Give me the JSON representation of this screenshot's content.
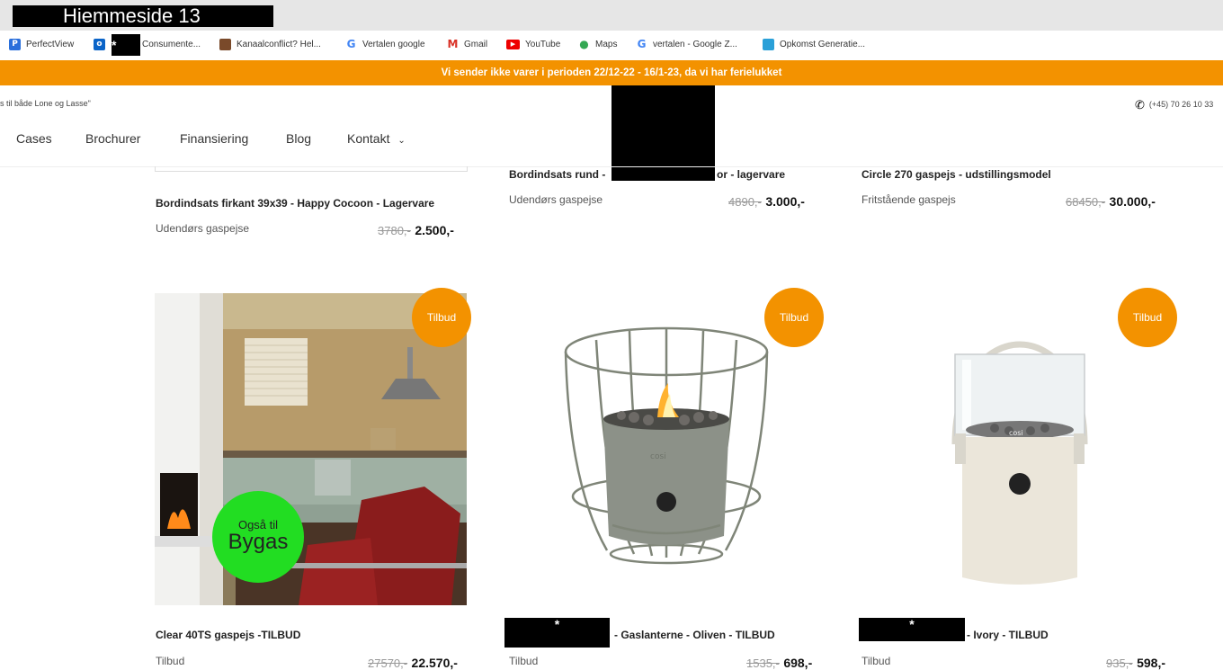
{
  "browser": {
    "tab_title": "Hiemmeside 13",
    "bookmarks": [
      {
        "label": "PerfectView",
        "icon": "perfectview-icon"
      },
      {
        "label": "",
        "icon": "outlook-icon"
      },
      {
        "label": "*",
        "icon": "redacted"
      },
      {
        "label": "Consumente...",
        "icon": ""
      },
      {
        "label": "Kanaalconflict? Hel...",
        "icon": "bookmark-image-icon"
      },
      {
        "label": "Vertalen google",
        "icon": "google-icon"
      },
      {
        "label": "Gmail",
        "icon": "gmail-icon"
      },
      {
        "label": "YouTube",
        "icon": "youtube-icon"
      },
      {
        "label": "Maps",
        "icon": "maps-icon"
      },
      {
        "label": "vertalen - Google Z...",
        "icon": "google-icon"
      },
      {
        "label": "Opkomst Generatie...",
        "icon": "page-icon"
      }
    ]
  },
  "banner": {
    "text": "Vi sender ikke varer i perioden 22/12-22 - 16/1-23, da vi har ferielukket"
  },
  "header": {
    "tagline": "s til både Lone og Lasse\"",
    "phone": "(+45) 70 26 10 33"
  },
  "nav": {
    "items": [
      "Cases",
      "Brochurer",
      "Finansiering",
      "Blog",
      "Kontakt"
    ]
  },
  "products_top": [
    {
      "title": "Bordindsats firkant 39x39 - Happy Cocoon - Lagervare",
      "category": "Udendørs gaspejse",
      "old_price": "3780,-",
      "price": "2.500,-"
    },
    {
      "title_left": "Bordindsats rund -",
      "title_right": "or - lagervare",
      "category": "Udendørs gaspejse",
      "old_price": "4890,-",
      "price": "3.000,-"
    },
    {
      "title": "Circle 270 gaspejs - udstillingsmodel",
      "category": "Fritstående gaspejs",
      "old_price": "68450,-",
      "price": "30.000,-"
    }
  ],
  "products_bottom": [
    {
      "badge": "Tilbud",
      "title": "Clear 40TS gaspejs -TILBUD",
      "category": "Tilbud",
      "old_price": "27570,-",
      "price": "22.570,-",
      "sticker_small": "Også til",
      "sticker_big": "Bygas"
    },
    {
      "badge": "Tilbud",
      "redacted": "*",
      "title": "- Gaslanterne - Oliven - TILBUD",
      "category": "Tilbud",
      "old_price": "1535,-",
      "price": "698,-",
      "logo_text": "cosi"
    },
    {
      "badge": "Tilbud",
      "redacted": "*",
      "title": "- Ivory - TILBUD",
      "category": "Tilbud",
      "old_price": "935,-",
      "price": "598,-",
      "logo_text": "cosi"
    }
  ],
  "colors": {
    "accent": "#f39200",
    "sticker": "#22dd22"
  }
}
